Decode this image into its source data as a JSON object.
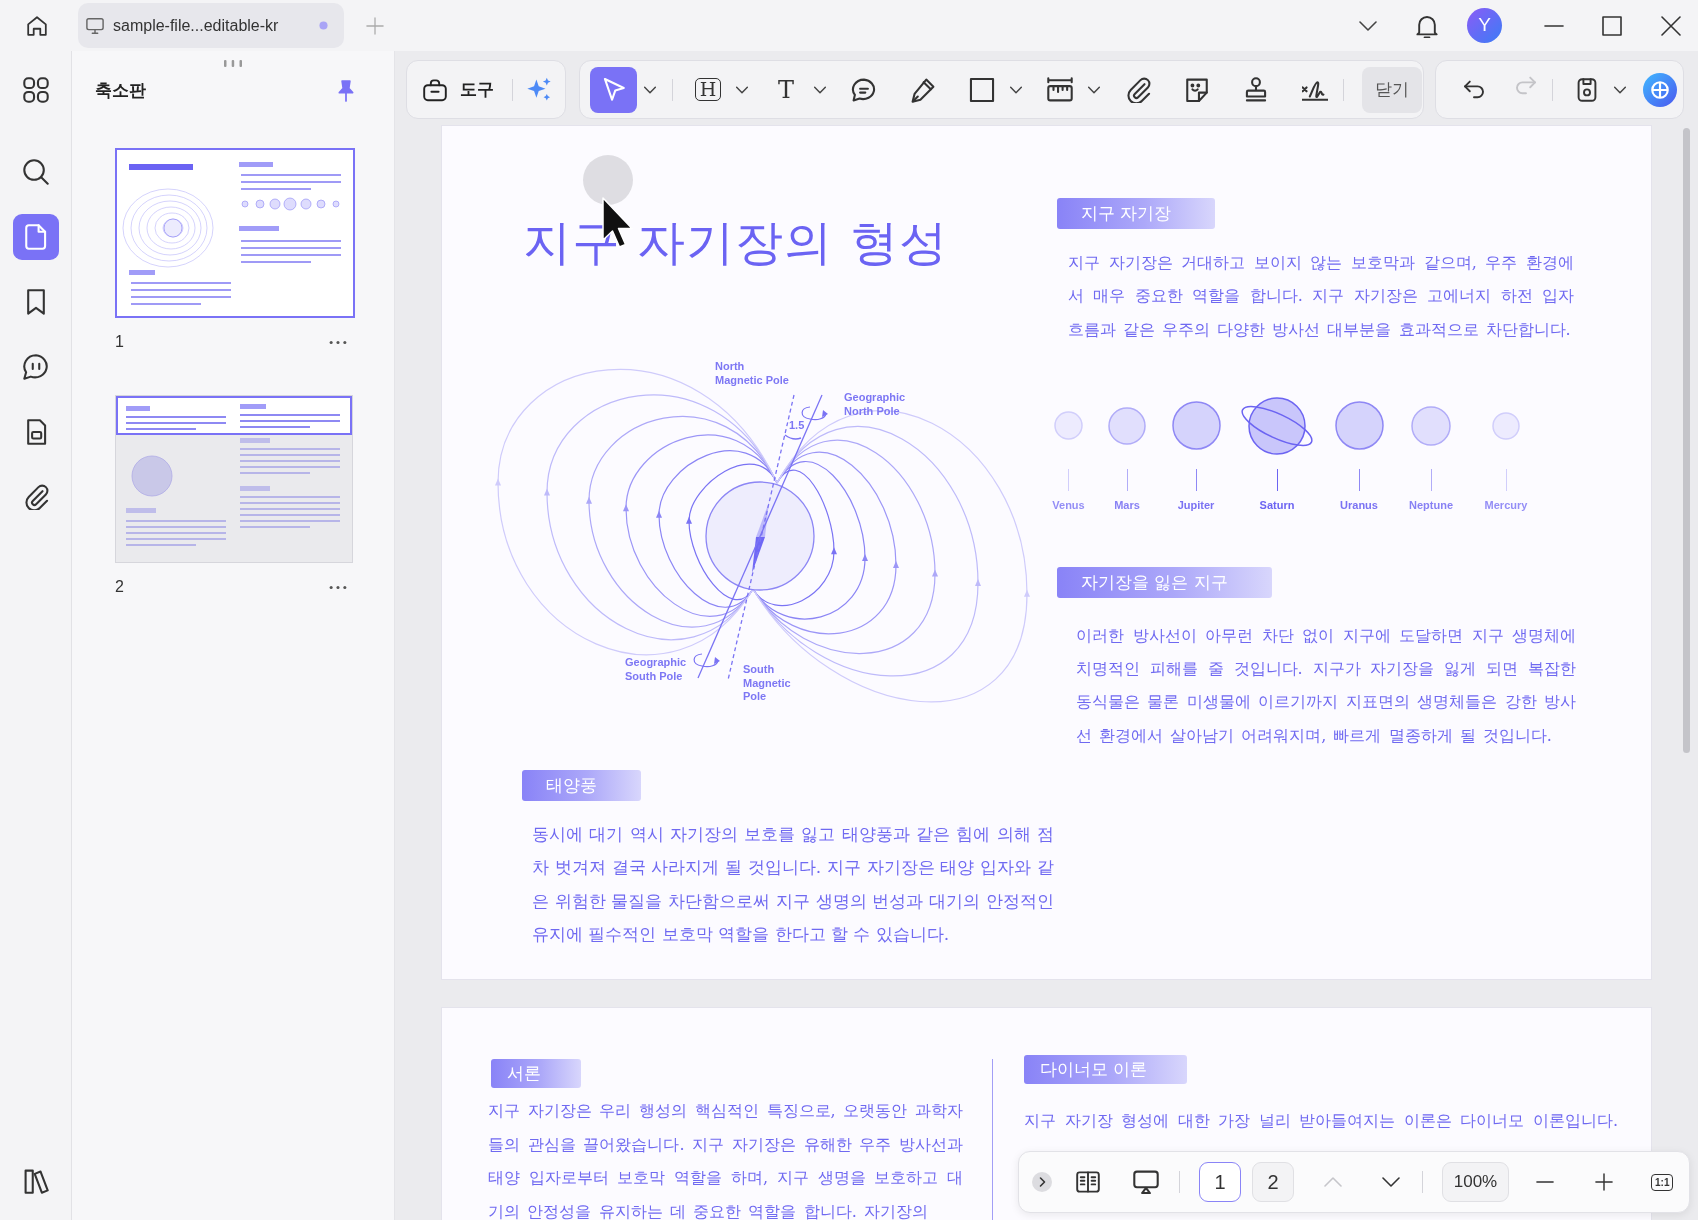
{
  "title_bar": {
    "tabs": [
      {
        "label": "sample-file...editable-kr",
        "selected": true,
        "unsaved": true
      }
    ],
    "avatar": "Y"
  },
  "sidebar": {
    "items": [
      {
        "kind": "apps",
        "selected": false
      },
      {
        "kind": "search",
        "selected": false
      },
      {
        "kind": "thumbnails",
        "selected": true
      },
      {
        "kind": "bookmarks",
        "selected": false
      },
      {
        "kind": "comments",
        "selected": false
      },
      {
        "kind": "forms",
        "selected": false
      },
      {
        "kind": "attachments",
        "selected": false
      }
    ],
    "bottom_items": [
      {
        "kind": "library",
        "selected": false
      }
    ]
  },
  "thumbnail_panel": {
    "title": "축소판",
    "pinned": true,
    "pages": [
      {
        "number": "1",
        "selected": true
      },
      {
        "number": "2",
        "selected": false
      }
    ]
  },
  "toolbar": {
    "tools_label": "도구",
    "tools": [
      {
        "kind": "select",
        "selected": true,
        "dropdown": true
      },
      {
        "kind": "heading",
        "glyph": "H",
        "selected": false,
        "dropdown": true
      },
      {
        "kind": "text",
        "glyph": "T",
        "selected": false,
        "dropdown": true
      },
      {
        "kind": "comment",
        "selected": false,
        "dropdown": false
      },
      {
        "kind": "pen",
        "selected": false,
        "dropdown": false
      },
      {
        "kind": "shape",
        "selected": false,
        "dropdown": true
      },
      {
        "kind": "measure",
        "selected": false,
        "dropdown": true
      },
      {
        "kind": "attach",
        "selected": false,
        "dropdown": false
      },
      {
        "kind": "sticker",
        "selected": false,
        "dropdown": false
      },
      {
        "kind": "stamp",
        "selected": false,
        "dropdown": false
      },
      {
        "kind": "sign",
        "selected": false,
        "dropdown": false
      }
    ],
    "close_label": "닫기",
    "history": [
      {
        "kind": "undo",
        "disabled": false
      },
      {
        "kind": "redo",
        "disabled": true
      }
    ]
  },
  "document": {
    "pages": [
      {
        "columns": [
          {
            "blocks": [
              {
                "kind": "title",
                "text": "지구 자기장의 형성"
              },
              {
                "kind": "diagram",
                "labels": [
                  "North\nMagnetic Pole",
                  "Geographic\nNorth Pole",
                  "1.5",
                  "Geographic\nSouth Pole",
                  "South\nMagnetic\nPole"
                ]
              },
              {
                "kind": "heading",
                "text": "태양풍"
              },
              {
                "kind": "paragraph",
                "text": "동시에 대기 역시 자기장의 보호를 잃고 태양풍과 같은 힘에 의해 점차 벗겨져 결국 사라지게 될 것입니다. 지구 자기장은 태양 입자와 같은 위험한 물질을 차단함으로써 지구 생명의 번성과 대기의 안정적인 유지에 필수적인 보호막 역할을 한다고 할 수 있습니다."
              }
            ]
          },
          {
            "blocks": [
              {
                "kind": "heading",
                "text": "지구 자기장"
              },
              {
                "kind": "paragraph",
                "text": "지구 자기장은 거대하고 보이지 않는 보호막과 같으며, 우주 환경에서 매우 중요한 역할을 합니다. 지구 자기장은 고에너지 하전 입자 흐름과 같은 우주의 다양한 방사선 대부분을 효과적으로 차단합니다."
              },
              {
                "kind": "planets",
                "planets": [
                  {
                    "name": "Venus",
                    "kind": "plain"
                  },
                  {
                    "name": "Mars",
                    "kind": "plain"
                  },
                  {
                    "name": "Jupiter",
                    "kind": "plain"
                  },
                  {
                    "name": "Saturn",
                    "kind": "ringed"
                  },
                  {
                    "name": "Uranus",
                    "kind": "plain"
                  },
                  {
                    "name": "Neptune",
                    "kind": "plain"
                  },
                  {
                    "name": "Mercury",
                    "kind": "plain"
                  }
                ]
              },
              {
                "kind": "heading",
                "text": "자기장을 잃은 지구"
              },
              {
                "kind": "paragraph",
                "text": "이러한 방사선이 아무런 차단 없이 지구에 도달하면 지구 생명체에 치명적인 피해를 줄 것입니다. 지구가 자기장을 잃게 되면 복잡한 동식물은 물론 미생물에 이르기까지 지표면의 생명체들은 강한 방사선 환경에서 살아남기 어려워지며, 빠르게 멸종하게 될 것입니다."
              }
            ]
          }
        ]
      },
      {
        "column_rule": true,
        "columns": [
          {
            "blocks": [
              {
                "kind": "heading",
                "text": "서론"
              },
              {
                "kind": "paragraph",
                "text": "지구 자기장은 우리 행성의 핵심적인 특징으로, 오랫동안 과학자들의 관심을 끌어왔습니다. 지구 자기장은 유해한 우주 방사선과 태양 입자로부터 보호막 역할을 하며, 지구 생명을 보호하고 대기의 안정성을 유지하는 데 중요한 역할을 합니다. 자기장의"
              }
            ]
          },
          {
            "blocks": [
              {
                "kind": "heading",
                "text": "다이너모 이론"
              },
              {
                "kind": "paragraph",
                "text": "지구 자기장 형성에 대한 가장 널리 받아들여지는 이론은 다이너모 이론입니다."
              }
            ]
          }
        ]
      }
    ]
  },
  "page_nav": {
    "pages": [
      {
        "label": "1",
        "selected": true
      },
      {
        "label": "2",
        "selected": false
      }
    ],
    "steps": [
      {
        "kind": "previous",
        "disabled": true
      },
      {
        "kind": "next",
        "disabled": false
      }
    ],
    "zoom": "100%",
    "actual_size": "1:1"
  }
}
